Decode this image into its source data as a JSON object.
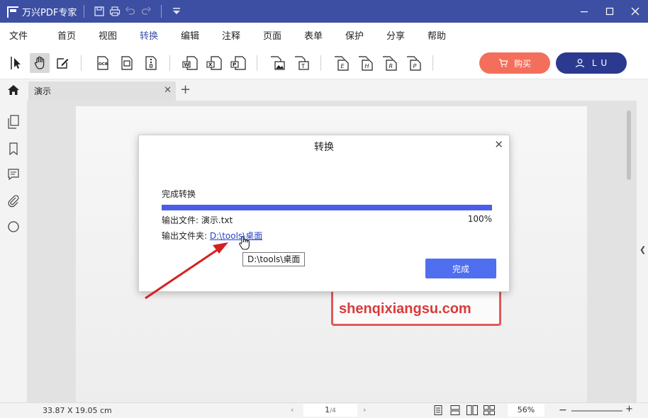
{
  "titlebar": {
    "app_title": "万兴PDF专家",
    "quick_icons": [
      "save-icon",
      "print-icon",
      "undo-icon",
      "redo-icon",
      "dropdown-icon"
    ],
    "window_controls": [
      "minimize-icon",
      "maximize-icon",
      "close-icon"
    ]
  },
  "menu": {
    "items": [
      "文件",
      "首页",
      "视图",
      "转换",
      "编辑",
      "注释",
      "页面",
      "表单",
      "保护",
      "分享",
      "帮助"
    ],
    "active": "转换"
  },
  "toolbar": {
    "tools": [
      "select-icon",
      "hand-icon",
      "edit-icon",
      "ocr-icon",
      "crop-icon",
      "zip-icon",
      "to-word-icon",
      "to-excel-icon",
      "to-ppt-icon",
      "to-image-icon",
      "to-text-icon",
      "to-epub-icon",
      "to-html-icon",
      "to-rtf-icon",
      "to-pdfa-icon"
    ],
    "ocr_label": "OCR",
    "buy_label": "购买",
    "user_label": "L U"
  },
  "tabs": {
    "doc_name": "演示",
    "new_tab": "+"
  },
  "dialog": {
    "title": "转换",
    "status": "完成转换",
    "progress_percent": 100,
    "progress_label": "100%",
    "file_label": "输出文件:",
    "file_name": "演示.txt",
    "folder_label": "输出文件夹:",
    "folder_path": "D:\\tools\\桌面",
    "done_button": "完成",
    "tooltip": "D:\\tools\\桌面"
  },
  "watermark": {
    "text": "shenqixiangsu.com"
  },
  "statusbar": {
    "dimensions": "33.87 X 19.05 cm",
    "current_page": "1",
    "total_pages": "/4",
    "zoom": "56%"
  },
  "colors": {
    "brand": "#3d4fa3",
    "buy": "#f36f5c",
    "user": "#2b3a8f",
    "progress": "#4b5de8",
    "done": "#4f6ef0",
    "arrow": "#d42020"
  }
}
